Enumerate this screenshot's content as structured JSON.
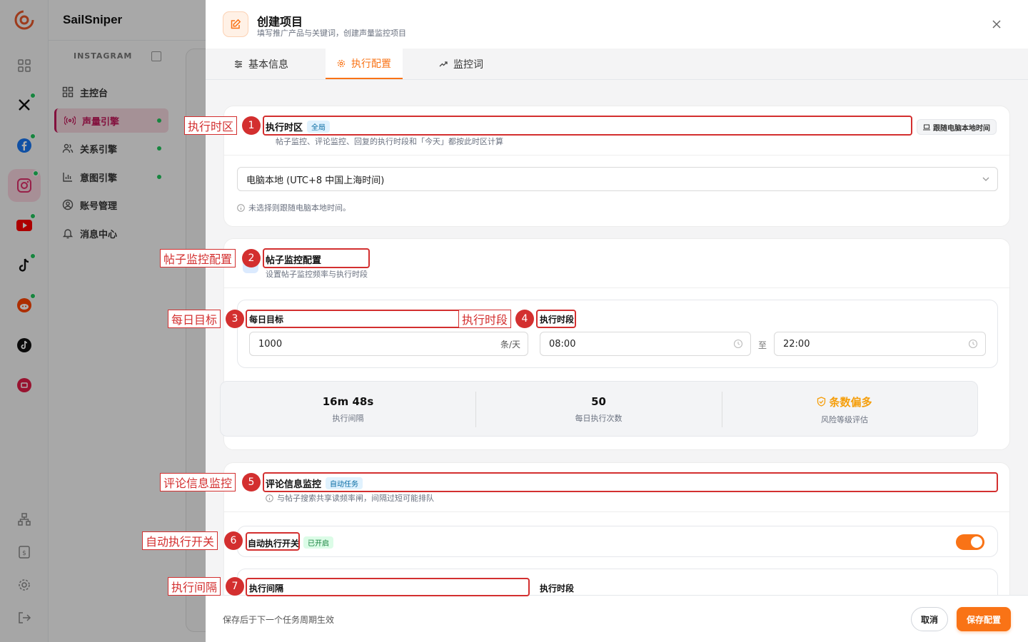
{
  "app": {
    "brand": "SailSniper",
    "platform_label": "INSTAGRAM"
  },
  "sidebar": {
    "items": [
      {
        "label": "主控台",
        "icon": "dashboard-icon"
      },
      {
        "label": "声量引擎",
        "icon": "radio-icon",
        "active": true
      },
      {
        "label": "关系引擎",
        "icon": "users-icon"
      },
      {
        "label": "意图引擎",
        "icon": "bar-chart-icon"
      },
      {
        "label": "账号管理",
        "icon": "account-icon"
      },
      {
        "label": "消息中心",
        "icon": "bell-icon"
      }
    ]
  },
  "drawer": {
    "title": "创建项目",
    "subtitle": "填写推广产品与关键词，创建声量监控项目",
    "tabs": {
      "basic": "基本信息",
      "exec": "执行配置",
      "monitor": "监控词"
    },
    "timezone": {
      "title": "执行时区",
      "badge": "全局",
      "desc": "帖子监控、评论监控、回复的执行时段和「今天」都按此时区计算",
      "follow_btn": "跟随电脑本地时间",
      "selected": "电脑本地 (UTC+8 中国上海时间)",
      "hint": "未选择则跟随电脑本地时间。"
    },
    "post_monitor": {
      "title": "帖子监控配置",
      "desc": "设置帖子监控频率与执行时段",
      "daily_target_label": "每日目标",
      "daily_target_value": "1000",
      "daily_target_unit": "条/天",
      "period_label": "执行时段",
      "start_time": "08:00",
      "to": "至",
      "end_time": "22:00",
      "stats": {
        "interval_value": "16m 48s",
        "interval_label": "执行间隔",
        "runs_value": "50",
        "runs_label": "每日执行次数",
        "risk_value": "条数偏多",
        "risk_label": "风险等级评估"
      }
    },
    "comment_monitor": {
      "title": "评论信息监控",
      "badge": "自动任务",
      "desc": "与帖子搜索共享读频率闸，间隔过短可能排队",
      "auto_label": "自动执行开关",
      "auto_badge": "已开启",
      "interval_label": "执行间隔",
      "period_label": "执行时段"
    },
    "footer": {
      "note": "保存后于下一个任务周期生效",
      "cancel": "取消",
      "save": "保存配置"
    }
  },
  "annotations": [
    {
      "num": "1",
      "label": "执行时区"
    },
    {
      "num": "2",
      "label": "帖子监控配置"
    },
    {
      "num": "3",
      "label": "每日目标"
    },
    {
      "num": "4",
      "label": "执行时段"
    },
    {
      "num": "5",
      "label": "评论信息监控"
    },
    {
      "num": "6",
      "label": "自动执行开关"
    },
    {
      "num": "7",
      "label": "执行间隔"
    }
  ],
  "colors": {
    "accent": "#f97316",
    "active_nav": "#c2185b",
    "annotation": "#d32f2f",
    "online": "#22c55e"
  }
}
